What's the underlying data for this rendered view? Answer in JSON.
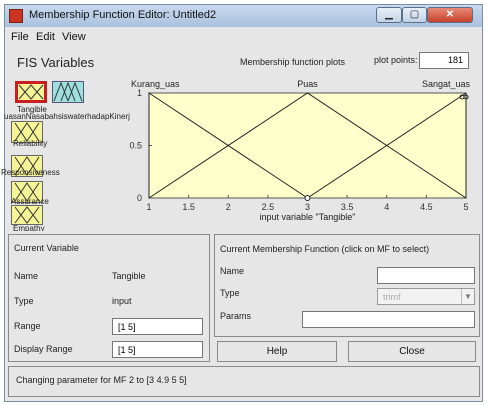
{
  "window": {
    "title": "Membership Function Editor: Untitled2",
    "close_glyph": "✕"
  },
  "menu": [
    "File",
    "Edit",
    "View"
  ],
  "fis": {
    "heading": "FIS Variables",
    "variables": [
      {
        "label": "Tangible",
        "kind": "input",
        "selected": true
      },
      {
        "label": "Kepuasan Nasabah",
        "kind": "output"
      },
      {
        "label": "Reliability",
        "kind": "input"
      },
      {
        "label": "Responsiveness",
        "kind": "input"
      },
      {
        "label": "Assurance",
        "kind": "input"
      },
      {
        "label": "Empathy",
        "kind": "input"
      }
    ],
    "overlap_label": "uasanNasabahsiswaterhadapKinerj"
  },
  "plot": {
    "title": "Membership function plots",
    "points_label": "plot points:",
    "points_value": "181",
    "xlabel": "input variable \"Tangible\""
  },
  "chart_data": {
    "type": "line",
    "xlim": [
      1,
      5
    ],
    "ylim": [
      0,
      1
    ],
    "xticks": [
      "1",
      "1.5",
      "2",
      "2.5",
      "3",
      "3.5",
      "4",
      "4.5",
      "5"
    ],
    "yticks": [
      "0",
      "0.5",
      "1"
    ],
    "xlabel": "input variable \"Tangible\"",
    "series": [
      {
        "name": "KurangPuas",
        "display": "Kurang_uas",
        "x": [
          1,
          1,
          3
        ],
        "y": [
          0,
          1,
          0
        ],
        "color": "#222222"
      },
      {
        "name": "Puas",
        "display": "Puas",
        "x": [
          1,
          3,
          5
        ],
        "y": [
          0,
          1,
          0
        ],
        "color": "#222222"
      },
      {
        "name": "SangatPuas",
        "display": "Sangat_uas",
        "x": [
          3,
          5,
          5
        ],
        "y": [
          0,
          1,
          0
        ],
        "color": "#222222"
      }
    ],
    "selected_mf_marker": {
      "x": 5,
      "y": 1
    },
    "background": "#ffffcc"
  },
  "current_variable": {
    "heading": "Current Variable",
    "name_label": "Name",
    "name_value": "Tangible",
    "type_label": "Type",
    "type_value": "input",
    "range_label": "Range",
    "range_value": "[1 5]",
    "display_range_label": "Display Range",
    "display_range_value": "[1 5]"
  },
  "current_mf": {
    "heading": "Current Membership Function (click on MF to select)",
    "name_label": "Name",
    "name_value": "",
    "type_label": "Type",
    "type_value": "trimf",
    "params_label": "Params",
    "params_value": ""
  },
  "buttons": {
    "help": "Help",
    "close": "Close"
  },
  "status": "Changing parameter for MF 2 to  [3 4.9 5 5]"
}
